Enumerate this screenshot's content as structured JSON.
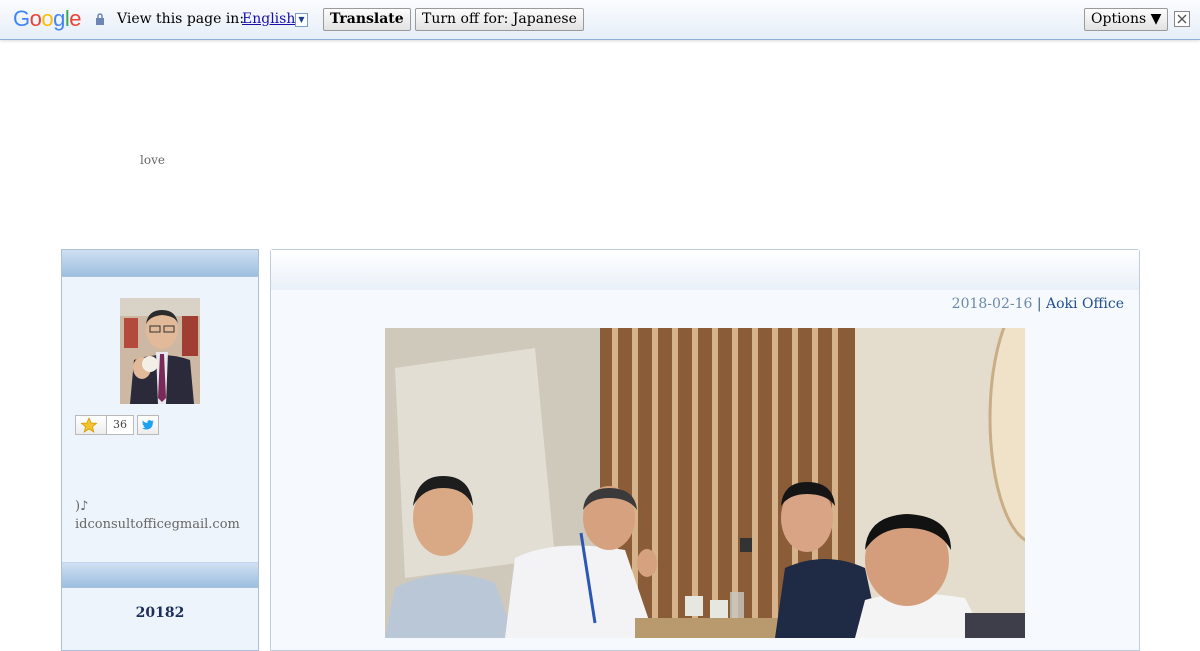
{
  "translate_bar": {
    "logo": [
      "G",
      "o",
      "o",
      "g",
      "l",
      "e"
    ],
    "view_text": "View this page in:",
    "language": "English",
    "translate_label": "Translate",
    "turn_off_label": "Turn off for: Japanese",
    "options_label": "Options ▼"
  },
  "header": {
    "tagline": "love"
  },
  "sidebar": {
    "rating_count": "36",
    "note_line1": ")♪",
    "note_line2": "idconsultofficegmail.com",
    "calendar_title": "20182"
  },
  "post": {
    "date": "2018-02-16",
    "separator": "|",
    "author": "Aoki Office"
  }
}
